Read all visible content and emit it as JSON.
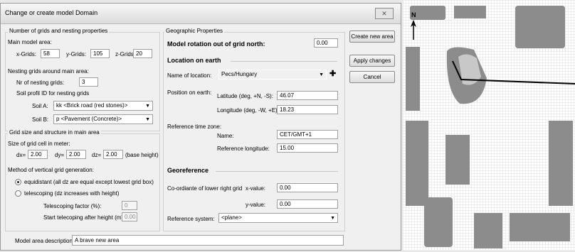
{
  "dialog": {
    "title": "Change or create model Domain",
    "close_label": "✕"
  },
  "grids": {
    "group_title": "Number of grids and nesting properties",
    "main_area_label": "Main model area:",
    "x_label": "x-Grids:",
    "x_value": "58",
    "y_label": "y-Grids:",
    "y_value": "105",
    "z_label": "z-Grids:",
    "z_value": "20",
    "nesting_label": "Nesting grids around main area:",
    "nr_nesting_label": "Nr of nesting grids:",
    "nr_nesting_value": "3",
    "soil_profil_label": "Soil profil ID for nesting grids",
    "soil_a_label": "Soil A:",
    "soil_a_value": "kk <Brick road (red stones)>",
    "soil_b_label": "Soil B:",
    "soil_b_value": "p <Pavement (Concrete)>"
  },
  "gridsize": {
    "group_title": "Grid size and structure in main area",
    "size_label": "Size of grid cell in meter:",
    "dx_label": "dx=",
    "dx_value": "2.00",
    "dy_label": "dy=",
    "dy_value": "2.00",
    "dz_label": "dz=",
    "dz_value": "2.00",
    "base_height_label": "(base height)",
    "method_label": "Method of vertical grid generation:",
    "equidistant_label": "equidistant (all dz are equal except lowest grid box)",
    "telescoping_label": "telescoping (dz increases with height)",
    "telescoping_factor_label": "Telescoping factor (%):",
    "telescoping_factor_value": "0",
    "start_telescoping_label": "Start telecoping after height (m):",
    "start_telescoping_value": "0.00"
  },
  "description": {
    "label": "Model area description:",
    "value": "A brave new area"
  },
  "geo": {
    "group_title": "Geographic Properties",
    "rotation_label": "Model rotation out of grid north:",
    "rotation_value": "0.00",
    "location_heading": "Location on earth",
    "location_name_label": "Name of location:",
    "location_name_value": "Pecs/Hungary",
    "add_symbol": "✚",
    "position_label": "Position on earth:",
    "latitude_label": "Latitude (deg, +N, -S):",
    "latitude_value": "46.07",
    "longitude_label": "Longitude (deg, -W, +E):",
    "longitude_value": "18.23",
    "timezone_label": "Reference time zone:",
    "tz_name_label": "Name:",
    "tz_name_value": "CET/GMT+1",
    "ref_longitude_label": "Reference longitude:",
    "ref_longitude_value": "15.00",
    "georef_heading": "Georeference",
    "lower_right_label": "Co-ordiante of lower right grid",
    "x_value_label": "x-value:",
    "x_value": "0.00",
    "y_value_label": "y-value:",
    "y_value": "0.00",
    "ref_system_label": "Reference system:",
    "ref_system_value": "<plane>"
  },
  "buttons": {
    "create_new_area": "Create new area",
    "apply_changes": "Apply changes",
    "cancel": "Cancel"
  },
  "map": {
    "north_label": "N",
    "colors": {
      "background": "#ffffff",
      "grid": "#c8c8c8",
      "building": "#8c8c8c",
      "highlight": "#c8c8c8",
      "line": "#000000"
    }
  }
}
